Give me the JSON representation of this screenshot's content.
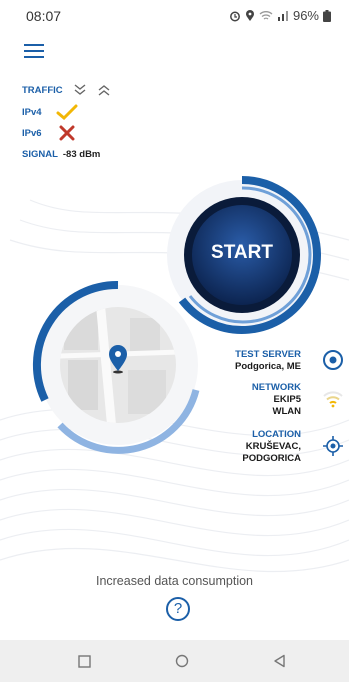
{
  "status_bar": {
    "time": "08:07",
    "battery": "96%"
  },
  "traffic": {
    "label": "TRAFFIC",
    "ipv4_label": "IPv4",
    "ipv6_label": "IPv6",
    "signal_label": "SIGNAL",
    "signal_value": "-83 dBm"
  },
  "start_button": {
    "label": "START"
  },
  "server": {
    "title": "TEST SERVER",
    "value": "Podgorica, ME"
  },
  "network": {
    "title": "NETWORK",
    "name": "EKIP5",
    "type": "WLAN"
  },
  "location": {
    "title": "LOCATION",
    "line1": "KRUŠEVAC,",
    "line2": "PODGORICA"
  },
  "footer": {
    "text": "Increased data consumption",
    "help_symbol": "?"
  },
  "colors": {
    "primary": "#1b5fa8",
    "dark_navy": "#0f2a55",
    "ok": "#f2b705",
    "error": "#c0392b"
  },
  "icons": [
    "menu-icon",
    "download-icon",
    "upload-icon",
    "check-icon",
    "cross-icon",
    "map-pin-icon",
    "target-icon",
    "wifi-icon",
    "locate-icon",
    "help-icon",
    "back-icon",
    "home-icon",
    "recents-icon"
  ]
}
